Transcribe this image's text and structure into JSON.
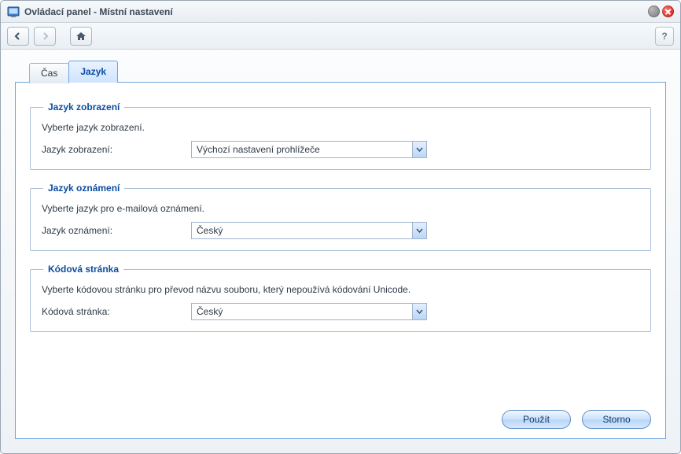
{
  "window": {
    "title": "Ovládací panel - Místní nastavení"
  },
  "tabs": {
    "time": "Čas",
    "language": "Jazyk"
  },
  "section_display": {
    "legend": "Jazyk zobrazení",
    "desc": "Vyberte jazyk zobrazení.",
    "label": "Jazyk zobrazení:",
    "value": "Výchozí nastavení prohlížeče"
  },
  "section_notify": {
    "legend": "Jazyk oznámení",
    "desc": "Vyberte jazyk pro e-mailová oznámení.",
    "label": "Jazyk oznámení:",
    "value": "Český"
  },
  "section_codepage": {
    "legend": "Kódová stránka",
    "desc": "Vyberte kódovou stránku pro převod názvu souboru, který nepoužívá kódování Unicode.",
    "label": "Kódová stránka:",
    "value": "Český"
  },
  "buttons": {
    "apply": "Použít",
    "cancel": "Storno"
  }
}
